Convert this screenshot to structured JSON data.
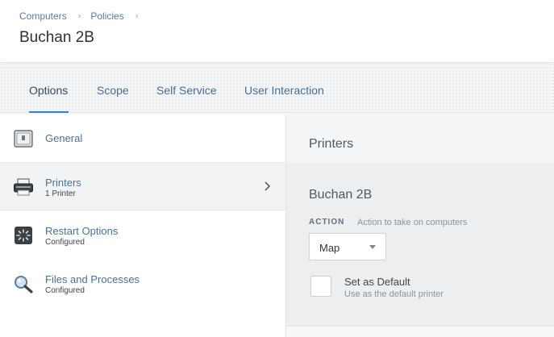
{
  "breadcrumb": {
    "items": [
      "Computers",
      "Policies"
    ],
    "separator": "›"
  },
  "page": {
    "title": "Buchan 2B"
  },
  "tabs": [
    {
      "label": "Options",
      "active": true
    },
    {
      "label": "Scope",
      "active": false
    },
    {
      "label": "Self Service",
      "active": false
    },
    {
      "label": "User Interaction",
      "active": false
    }
  ],
  "nav": {
    "items": [
      {
        "title": "General",
        "subtitle": "",
        "icon": "general-icon",
        "selected": false
      },
      {
        "title": "Printers",
        "subtitle": "1 Printer",
        "icon": "printer-icon",
        "selected": true
      },
      {
        "title": "Restart Options",
        "subtitle": "Configured",
        "icon": "restart-icon",
        "selected": false
      },
      {
        "title": "Files and Processes",
        "subtitle": "Configured",
        "icon": "magnifier-icon",
        "selected": false
      }
    ]
  },
  "panel": {
    "title": "Printers",
    "printer_name": "Buchan 2B",
    "action_label": "ACTION",
    "action_help": "Action to take on computers",
    "action_value": "Map",
    "default_label": "Set as Default",
    "default_help": "Use as the default printer",
    "default_checked": false
  },
  "colors": {
    "accent": "#2f84d1",
    "link": "#4f6f91"
  }
}
